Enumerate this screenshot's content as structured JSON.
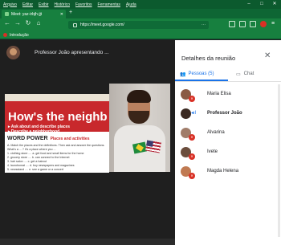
{
  "browser": {
    "menu": [
      "Arquivo",
      "Editar",
      "Exibir",
      "Histórico",
      "Favoritos",
      "Ferramentas",
      "Ajuda"
    ],
    "window_controls": [
      "–",
      "□",
      "✕"
    ],
    "tab_title": "Meet: yaz-irbjh-jjt",
    "tab_close": "✕",
    "new_tab": "+",
    "url": "https://meet.google.com/",
    "url_menu": "···",
    "bookmark": "Introdução"
  },
  "meet": {
    "presenter_label": "Professor João apresentando ...",
    "slide": {
      "title": "How's the neighb",
      "bullets": [
        "Ask about and describe places",
        "Describe a neighborhood"
      ],
      "section": "WORD POWER",
      "section_sub": "Places and activities",
      "lines": [
        "A. Match the places and the definitions. Then ask and answer the questions.",
        "What's a ... ?        It's a place where you ...",
        "1. clothing store ....    a. get food and small items for the home",
        "2. grocery store ....     b. can connect to the Internet",
        "3. hair salon ....        c. get a haircut",
        "4. laundromat ....        d. buy newspapers and magazines",
        "5. newsstand ....         e. see a game or a concert"
      ]
    }
  },
  "panel": {
    "title": "Detalhes da reunião",
    "close_icon": "✕",
    "tab_people": "Pessoas (5)",
    "tab_chat": "Chat",
    "participants": [
      {
        "name": "Maria Elisa",
        "avatar_color": "#8a5a44"
      },
      {
        "name": "Professor João",
        "avatar_color": "#3b2a22"
      },
      {
        "name": "Alvarina",
        "avatar_color": "#a07d6a"
      },
      {
        "name": "Ivete",
        "avatar_color": "#6b4e3d"
      },
      {
        "name": "Magda Helena",
        "avatar_color": "#c07a52"
      }
    ]
  },
  "colors": {
    "accent": "#1a73e8",
    "mute_badge": "#d93025",
    "browser_green": "#17803f"
  }
}
